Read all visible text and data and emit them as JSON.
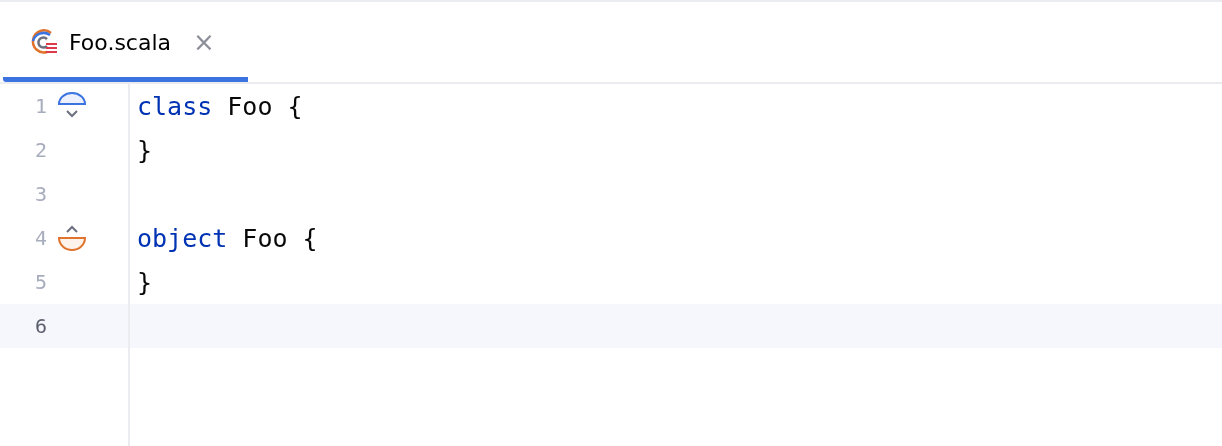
{
  "tabs": [
    {
      "label": "Foo.scala",
      "close": "×",
      "selected": true
    }
  ],
  "editor": {
    "lines": [
      {
        "number": "1",
        "gutter_icon": {
          "kind": "class"
        },
        "selected": false,
        "tokens": [
          {
            "text": "class",
            "kind": "keyword"
          },
          {
            "text": " Foo {",
            "kind": "plain"
          }
        ]
      },
      {
        "number": "2",
        "selected": false,
        "tokens": [
          {
            "text": "}",
            "kind": "plain"
          }
        ]
      },
      {
        "number": "3",
        "selected": false
      },
      {
        "number": "4",
        "gutter_icon": {
          "kind": "object"
        },
        "selected": false,
        "tokens": [
          {
            "text": "object",
            "kind": "keyword"
          },
          {
            "text": " Foo {",
            "kind": "plain"
          }
        ]
      },
      {
        "number": "5",
        "selected": false,
        "tokens": [
          {
            "text": "}",
            "kind": "plain"
          }
        ]
      },
      {
        "number": "6",
        "selected": true
      }
    ]
  }
}
